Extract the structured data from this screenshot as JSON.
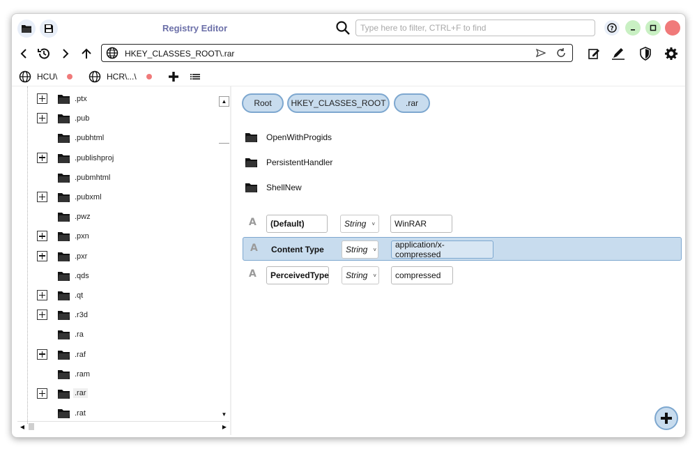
{
  "window": {
    "title": "Registry Editor"
  },
  "search": {
    "placeholder": "Type here to filter, CTRL+F to find",
    "value": ""
  },
  "address": {
    "path": "HKEY_CLASSES_ROOT\\.rar"
  },
  "tabs": [
    {
      "label": "HCU\\"
    },
    {
      "label": "HCR\\...\\"
    }
  ],
  "tree": {
    "items": [
      {
        "label": ".ptx",
        "expandable": true
      },
      {
        "label": ".pub",
        "expandable": true
      },
      {
        "label": ".pubhtml",
        "expandable": false
      },
      {
        "label": ".publishproj",
        "expandable": true
      },
      {
        "label": ".pubmhtml",
        "expandable": false
      },
      {
        "label": ".pubxml",
        "expandable": true
      },
      {
        "label": ".pwz",
        "expandable": false
      },
      {
        "label": ".pxn",
        "expandable": true
      },
      {
        "label": ".pxr",
        "expandable": true
      },
      {
        "label": ".qds",
        "expandable": false
      },
      {
        "label": ".qt",
        "expandable": true
      },
      {
        "label": ".r3d",
        "expandable": true
      },
      {
        "label": ".ra",
        "expandable": false
      },
      {
        "label": ".raf",
        "expandable": true
      },
      {
        "label": ".ram",
        "expandable": false
      },
      {
        "label": ".rar",
        "expandable": true,
        "selected": true
      },
      {
        "label": ".rat",
        "expandable": false
      }
    ]
  },
  "breadcrumbs": [
    "Root",
    "HKEY_CLASSES_ROOT",
    ".rar"
  ],
  "subkeys": [
    "OpenWithProgids",
    "PersistentHandler",
    "ShellNew"
  ],
  "values": [
    {
      "icon": "A",
      "name": "(Default)",
      "type": "String",
      "data": "WinRAR",
      "selected": false
    },
    {
      "icon": "A",
      "name": "Content Type",
      "type": "String",
      "data": "application/x-compressed",
      "selected": true
    },
    {
      "icon": "A",
      "name": "PerceivedType",
      "type": "String",
      "data": "compressed",
      "selected": false
    }
  ],
  "colors": {
    "accent": "#c8dcee",
    "accent_border": "#7da7cf",
    "minimize": "#c9f0c3",
    "maximize": "#c9f0c3",
    "close": "#f07a7a",
    "title": "#6b6fa8"
  }
}
